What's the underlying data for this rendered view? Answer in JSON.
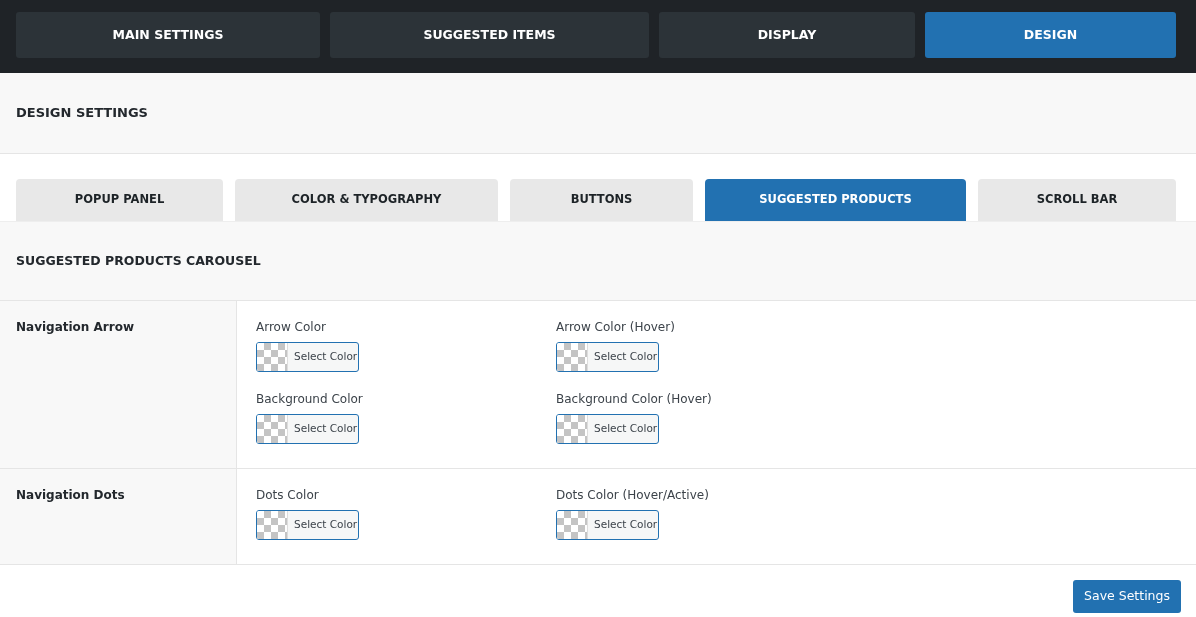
{
  "main_tabs": [
    {
      "label": "MAIN SETTINGS",
      "selected": false
    },
    {
      "label": "SUGGESTED ITEMS",
      "selected": false
    },
    {
      "label": "DISPLAY",
      "selected": false
    },
    {
      "label": "DESIGN",
      "selected": true
    }
  ],
  "section_title": "DESIGN SETTINGS",
  "sub_tabs": [
    {
      "label": "POPUP PANEL",
      "selected": false
    },
    {
      "label": "COLOR & TYPOGRAPHY",
      "selected": false
    },
    {
      "label": "BUTTONS",
      "selected": false
    },
    {
      "label": "SUGGESTED PRODUCTS",
      "selected": true
    },
    {
      "label": "SCROLL BAR",
      "selected": false
    }
  ],
  "panel_title": "SUGGESTED PRODUCTS CAROUSEL",
  "groups": [
    {
      "label": "Navigation Arrow",
      "fields": [
        {
          "label": "Arrow Color",
          "button": "Select Color"
        },
        {
          "label": "Arrow Color (Hover)",
          "button": "Select Color"
        },
        {
          "label": "Background Color",
          "button": "Select Color"
        },
        {
          "label": "Background Color (Hover)",
          "button": "Select Color"
        }
      ]
    },
    {
      "label": "Navigation Dots",
      "fields": [
        {
          "label": "Dots Color",
          "button": "Select Color"
        },
        {
          "label": "Dots Color (Hover/Active)",
          "button": "Select Color"
        }
      ]
    }
  ],
  "save_button": "Save Settings"
}
